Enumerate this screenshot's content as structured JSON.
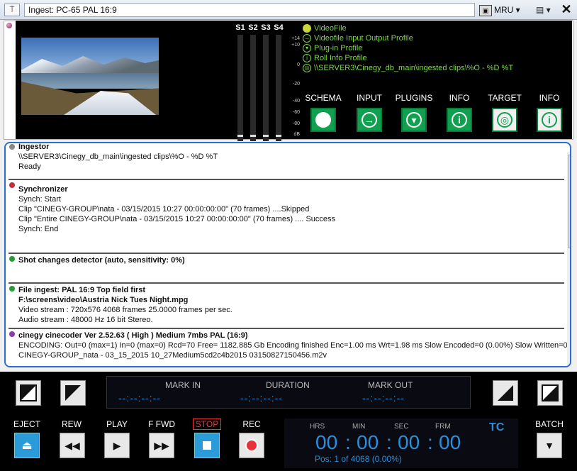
{
  "window": {
    "title": "Ingest: PC-65 PAL 16:9",
    "mru_label": "MRU"
  },
  "audio": {
    "channels": [
      "S1",
      "S2",
      "S3",
      "S4"
    ],
    "db_scale": [
      "+14",
      "+10",
      "0",
      "-20",
      "-40",
      "-60",
      "-80",
      "dB"
    ]
  },
  "info_lines": [
    {
      "icon": "dot-icon",
      "text": "VideoFile"
    },
    {
      "icon": "arrow-right-icon",
      "text": "Videofile Input Output Profile"
    },
    {
      "icon": "chevron-down-icon",
      "text": "Plug-in Profile"
    },
    {
      "icon": "info-icon",
      "text": "Roll Info Profile"
    },
    {
      "icon": "target-icon",
      "text": "\\\\SERVER3\\Cinegy_db_main\\ingested clips\\%O - %D %T"
    }
  ],
  "toolbar": [
    {
      "label": "SCHEMA",
      "icon": "circle-icon"
    },
    {
      "label": "INPUT",
      "icon": "arrow-right-icon"
    },
    {
      "label": "PLUGINS",
      "icon": "chevron-down-icon"
    },
    {
      "label": "INFO",
      "icon": "info-icon"
    },
    {
      "label": "TARGET",
      "icon": "target-icon"
    },
    {
      "label": "INFO",
      "icon": "info-icon"
    }
  ],
  "log": {
    "sections": [
      {
        "title": "Ingestor",
        "color": "#888888",
        "lines": [
          "\\\\SERVER3\\Cinegy_db_main\\ingested clips\\%O - %D %T",
          "Ready"
        ]
      },
      {
        "title": "Synchronizer",
        "color": "#c0303a",
        "lines": [
          "Synch: Start",
          "Clip \"CINEGY-GROUP\\nata - 03/15/2015 10:27 00:00:00:00\" (70 frames) ....Skipped",
          "Clip \"Entire CINEGY-GROUP\\nata - 03/15/2015 10:27 00:00:00:00\" (70 frames) .... Success",
          "Synch: End"
        ]
      },
      {
        "title": "Shot changes detector (auto, sensitivity: 0%)",
        "color": "#2a9a3a",
        "lines": []
      },
      {
        "title": "File ingest: PAL 16:9 Top field first",
        "color": "#2a9a3a",
        "lines": [
          "F:\\screens\\video\\Austria Nick Tues Night.mpg",
          "Video stream : 720x576 4068 frames 25.0000 frames per sec.",
          "Audio stream : 48000 Hz 16 bit Stereo."
        ]
      },
      {
        "title": "cinegy cinecoder Ver 2.52.63 ( High ) Medium 7mbs PAL (16:9)",
        "color": "#8a3ab0",
        "lines": [
          "ENCODING: Out=0 (max=1) In=0 (max=0) Rcd=70 Free= 1182.885 Gb   Encoding finished Enc=1.00 ms Wrt=1.98 ms Slow Encoded=0 (0.00%) Slow Written=0 (0",
          "CINEGY-GROUP_nata - 03_15_2015 10_27Medium5cd2c4b2015 03150827150456.m2v"
        ]
      }
    ]
  },
  "marks": {
    "mark_in_label": "MARK IN",
    "duration_label": "DURATION",
    "mark_out_label": "MARK OUT",
    "mark_in_value": "--:--:--:--",
    "duration_value": "--:--:--:--",
    "mark_out_value": "--:--:--:--"
  },
  "transport": [
    {
      "label": "EJECT",
      "icon": "eject-icon"
    },
    {
      "label": "REW",
      "icon": "rewind-icon"
    },
    {
      "label": "PLAY",
      "icon": "play-icon"
    },
    {
      "label": "F FWD",
      "icon": "fast-forward-icon"
    },
    {
      "label": "STOP",
      "icon": "stop-icon"
    },
    {
      "label": "REC",
      "icon": "record-icon"
    }
  ],
  "timecode": {
    "hrs_label": "HRS",
    "min_label": "MIN",
    "sec_label": "SEC",
    "frm_label": "FRM",
    "hrs": "00",
    "min": "00",
    "sec": "00",
    "frm": "00",
    "tc_label": "TC",
    "position": "Pos: 1 of 4068 (0.00%)"
  },
  "batch_label": "BATCH",
  "colors": {
    "accent_blue": "#2a8fd8",
    "green": "#11a050",
    "profile_green": "#7fd847"
  }
}
